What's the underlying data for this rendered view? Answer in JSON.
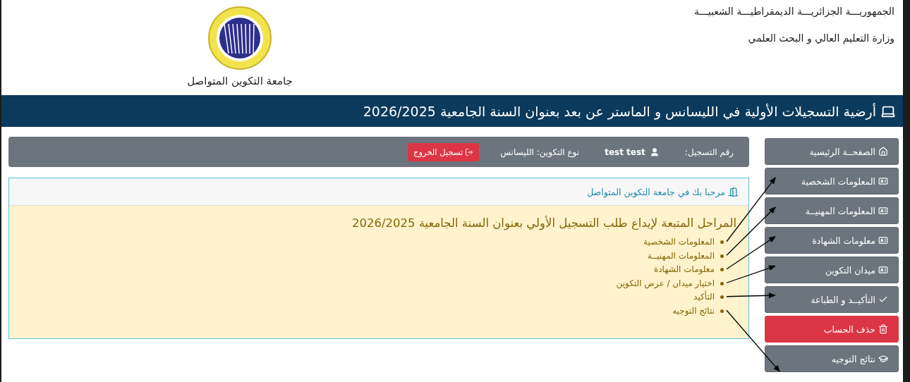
{
  "header": {
    "country": "الجمهوريـــة الجزائريـــة الديمقراطيـــة الشعبيـــة",
    "ministry": "وزارة التعليم العالي و البحث العلمي",
    "university": "جامعة التكوين المتواصل"
  },
  "banner": {
    "title": "أرضية التسجيلات الأولية في الليسانس و الماستر عن بعد بعنوان السنة الجامعية 2026/2025"
  },
  "info_bar": {
    "registration_label": "رقم التسجيل:",
    "user": "test test",
    "training_type": "نوع التكوين: الليسانس",
    "logout": "تسجيل الخروج"
  },
  "welcome_card": {
    "heading": "مرحبا بك في جامعة التكوين المتواصل",
    "title": "المراحل المتبعة لإيداع طلب التسجيل الأولي بعنوان السنة الجامعية 2026/2025",
    "steps": [
      "المعلومات الشخصية",
      "المعلومات المهنيــة",
      "معلومات الشهادة",
      "اختيار ميدان / عرض التكوين",
      "التأكيد",
      "نتائج التوجيه"
    ]
  },
  "sidebar": {
    "items": [
      {
        "label": "الصفحــة الرئيسية",
        "kind": "link"
      },
      {
        "label": "المعلومات الشخصية",
        "kind": "link"
      },
      {
        "label": "المعلومات المهنيــة",
        "kind": "link"
      },
      {
        "label": "معلومات الشهادة",
        "kind": "link"
      },
      {
        "label": "ميدان التكوين",
        "kind": "link"
      },
      {
        "label": "التأكيــد و الطباعة",
        "kind": "link"
      },
      {
        "label": "حذف الحساب",
        "kind": "danger"
      },
      {
        "label": "نتائج التوجيه",
        "kind": "link"
      }
    ]
  }
}
